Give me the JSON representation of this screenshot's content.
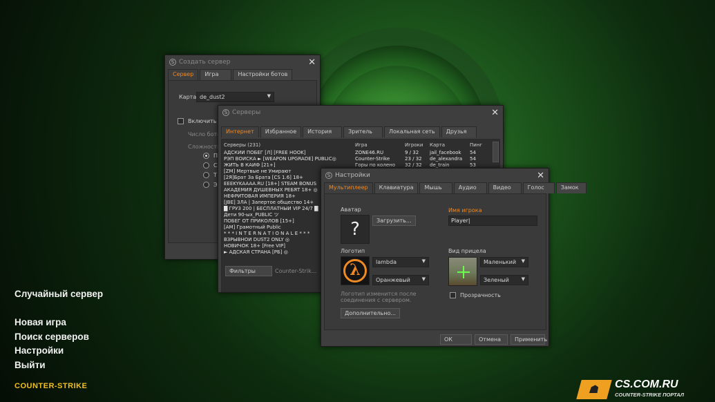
{
  "colors": {
    "accent": "#f08a24",
    "background": "#0d2b0e",
    "window": "#3e3e3e"
  },
  "create_server": {
    "title": "Создать сервер",
    "tabs": [
      "Сервер",
      "Игра",
      "Настройки ботов"
    ],
    "map_label": "Карта",
    "map_value": "de_dust2",
    "enable_label": "Включить б",
    "bot_count_label": "Число бото",
    "difficulty_label": "Сложность",
    "radio_items": [
      "П",
      "С",
      "Т",
      "Э"
    ]
  },
  "servers": {
    "title": "Серверы",
    "tabs": [
      "Интернет",
      "Избранное",
      "История",
      "Зритель",
      "Локальная сеть",
      "Друзья"
    ],
    "columns": [
      "Серверы (231)",
      "Игра",
      "Игроки",
      "Карта",
      "Пинг"
    ],
    "rows": [
      [
        "АДСКИЙ ПОБЕГ [Л] [FREE HOOK]",
        "ZONE46.RU",
        "9 / 32",
        "jail_facebook",
        "54"
      ],
      [
        "РЭП ВОЙСКА ► [WEAPON UPGRADE] PUBLIC◎",
        "Counter-Strike",
        "23 / 32",
        "de_alexandra",
        "54"
      ],
      [
        "ЖИТЬ В КАЙФ [21+]",
        "Горы по колено",
        "32 / 32",
        "de_train",
        "53"
      ],
      [
        "[ZM] Мертвые не Умирают",
        "",
        "",
        "",
        ""
      ],
      [
        "[2Я]Брат За Брата [CS 1.6] 18+",
        "",
        "",
        "",
        ""
      ],
      [
        "EEEKYKAAAA.RU [18+] STEAM BONUS",
        "",
        "",
        "",
        ""
      ],
      [
        "АКАДЕМИЯ ДУШЕВНЫХ РЕБЯТ 18+ ◎",
        "",
        "",
        "",
        ""
      ],
      [
        "НЕФРИТОВАЯ ИМПЕРИЯ 18+",
        "",
        "",
        "",
        ""
      ],
      [
        "[JBE] ЗЛА | Запертое общество 14+",
        "",
        "",
        "",
        ""
      ],
      [
        "█ ГРУЗ 200 | БЕСПЛАТНЫЙ VIP 24/7 █",
        "",
        "",
        "",
        ""
      ],
      [
        "Дети 90-ых_PUBLIC ツ",
        "",
        "",
        "",
        ""
      ],
      [
        "ПОБЕГ ОТ ПРИКОЛОВ [15+]",
        "",
        "",
        "",
        ""
      ],
      [
        "[AM] Грамотный Public",
        "",
        "",
        "",
        ""
      ],
      [
        "* * * I N T E R N A T I O N A L E * * *",
        "",
        "",
        "",
        ""
      ],
      [
        "ВЗРЫВНОЙ DUST2 ONLY ◎",
        "",
        "",
        "",
        ""
      ],
      [
        "НОВИЧОК 18+ [Free VIP]",
        "",
        "",
        "",
        ""
      ],
      [
        "► АДСКАЯ СТРАНА [РБ] ◎",
        "",
        "",
        "",
        ""
      ]
    ],
    "filters_label": "Фильтры",
    "filter_info": "Counter-Strik..."
  },
  "settings": {
    "title": "Настройки",
    "tabs": [
      "Мультиплеер",
      "Клавиатура",
      "Мышь",
      "Аудио",
      "Видео",
      "Голос",
      "Замок"
    ],
    "avatar_label": "Аватар",
    "avatar_placeholder": "?",
    "upload_button": "Загрузить...",
    "player_name_label": "Имя игрока",
    "player_name_value": "Player",
    "logo_label": "Логотип",
    "logo_value": "lambda",
    "logo_color_value": "Оранжевый",
    "logo_note": "Логотип изменится после соединения с сервером.",
    "advanced_button": "Дополнительно...",
    "crosshair_label": "Вид прицела",
    "crosshair_size_value": "Маленький",
    "crosshair_color_value": "Зеленый",
    "transparency_label": "Прозрачность",
    "ok_button": "ОК",
    "cancel_button": "Отмена",
    "apply_button": "Применить"
  },
  "main_menu": {
    "random_server": "Случайный сервер",
    "new_game": "Новая игра",
    "find_servers": "Поиск серверов",
    "settings": "Настройки",
    "quit": "Выйти"
  },
  "brand": {
    "game_logo": "COUNTER-STRIKE",
    "site_logo": "CS.COM.RU",
    "site_tagline": "COUNTER-STRIKE ПОРТАЛ"
  }
}
